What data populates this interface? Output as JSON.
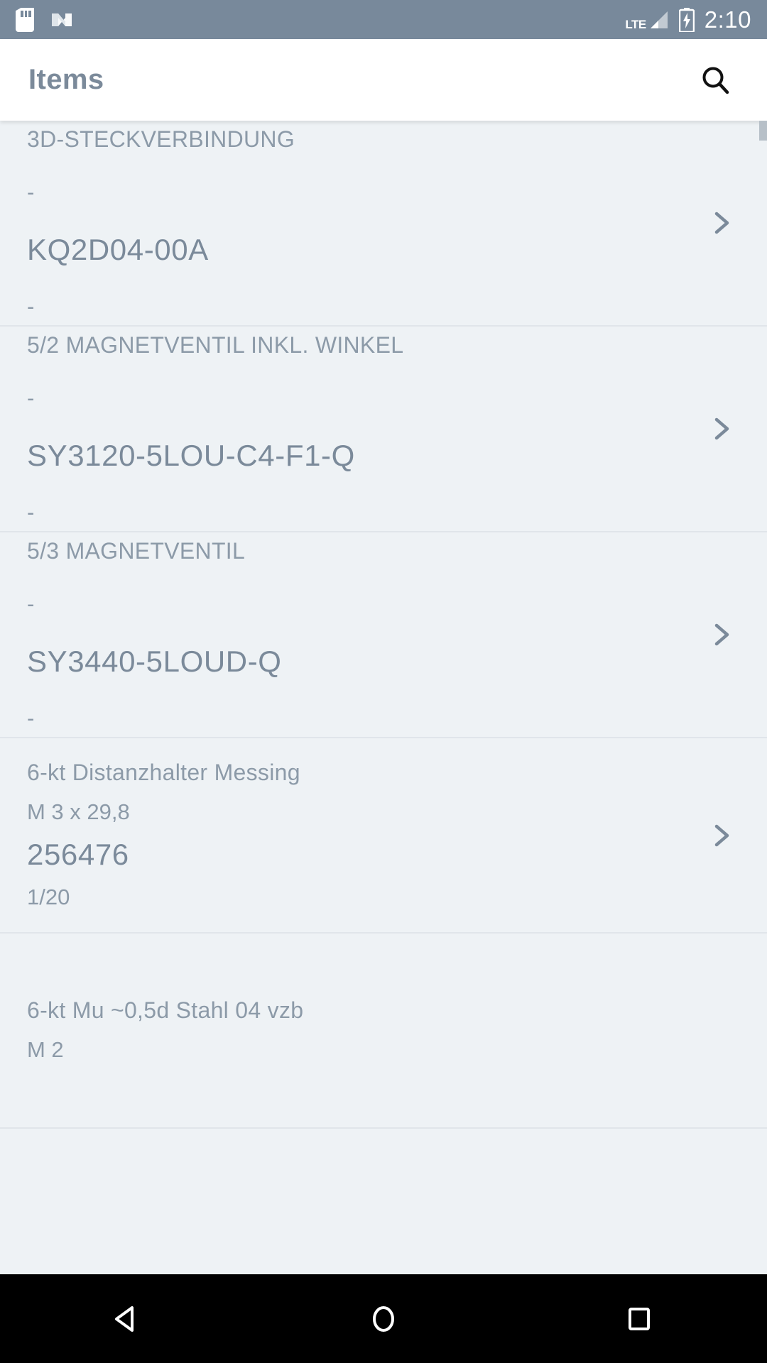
{
  "status_bar": {
    "icons_left": [
      "sd-card-icon",
      "android-nougat-icon"
    ],
    "network_label": "LTE",
    "icons_right": [
      "signal-icon",
      "battery-charging-icon"
    ],
    "time": "2:10",
    "background_color": "#78899b"
  },
  "app_bar": {
    "title": "Items",
    "search_icon": "search-icon",
    "background_color": "#ffffff",
    "title_color": "#7b8a9a"
  },
  "list": {
    "background_color": "#eef2f5",
    "chevron_icon": "chevron-right-icon",
    "items": [
      {
        "name": "3D-STECKVERBINDUNG",
        "description": "-",
        "code": "KQ2D04-00A",
        "quantity": "-"
      },
      {
        "name": "5/2 MAGNETVENTIL INKL. WINKEL",
        "description": "-",
        "code": "SY3120-5LOU-C4-F1-Q",
        "quantity": "-"
      },
      {
        "name": "5/3 MAGNETVENTIL",
        "description": "-",
        "code": "SY3440-5LOUD-Q",
        "quantity": "-"
      },
      {
        "name": "6-kt Distanzhalter Messing",
        "description": "M 3 x 29,8",
        "code": "256476",
        "quantity": "1/20"
      },
      {
        "name": "6-kt Mu ~0,5d Stahl 04 vzb",
        "description": "M 2",
        "code": "",
        "quantity": ""
      }
    ]
  },
  "nav_bar": {
    "background_color": "#000000",
    "buttons": [
      "back-icon",
      "home-icon",
      "recents-icon"
    ]
  }
}
